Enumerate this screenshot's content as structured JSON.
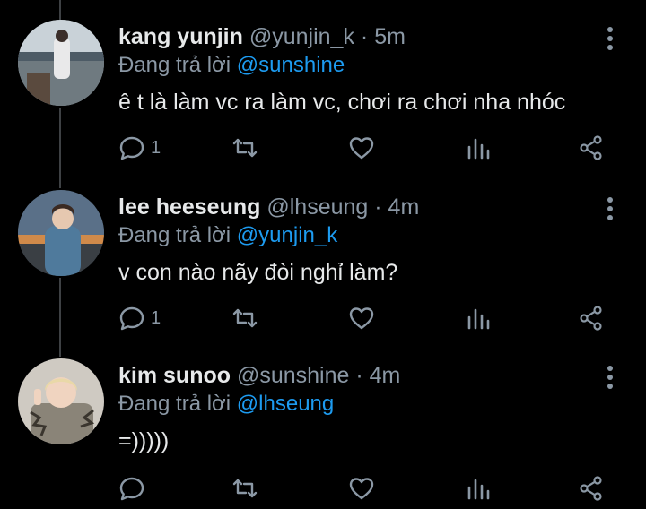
{
  "colors": {
    "background": "#000000",
    "text": "#e7e9ea",
    "muted": "#8b98a5",
    "link": "#1d9bf0",
    "thread_line": "#3e4144"
  },
  "icons": {
    "reply": "speech-bubble-icon",
    "retweet": "retweet-icon",
    "like": "heart-icon",
    "views": "bar-chart-icon",
    "share": "share-icon",
    "more": "vertical-ellipsis-icon"
  },
  "tweets": [
    {
      "name": "kang yunjin",
      "handle": "@yunjin_k",
      "separator": "·",
      "time": "5m",
      "reply_prefix": "Đang trả lời",
      "reply_to": "@sunshine",
      "text": "ê t là làm vc ra làm vc, chơi ra chơi nha nhóc",
      "reply_count": "1"
    },
    {
      "name": "lee heeseung",
      "handle": "@lhseung",
      "separator": "·",
      "time": "4m",
      "reply_prefix": "Đang trả lời",
      "reply_to": "@yunjin_k",
      "text": "v con nào nãy đòi nghỉ làm?",
      "reply_count": "1"
    },
    {
      "name": "kim sunoo",
      "handle": "@sunshine",
      "separator": "·",
      "time": "4m",
      "reply_prefix": "Đang trả lời",
      "reply_to": "@lhseung",
      "text": "=)))))",
      "reply_count": ""
    }
  ]
}
